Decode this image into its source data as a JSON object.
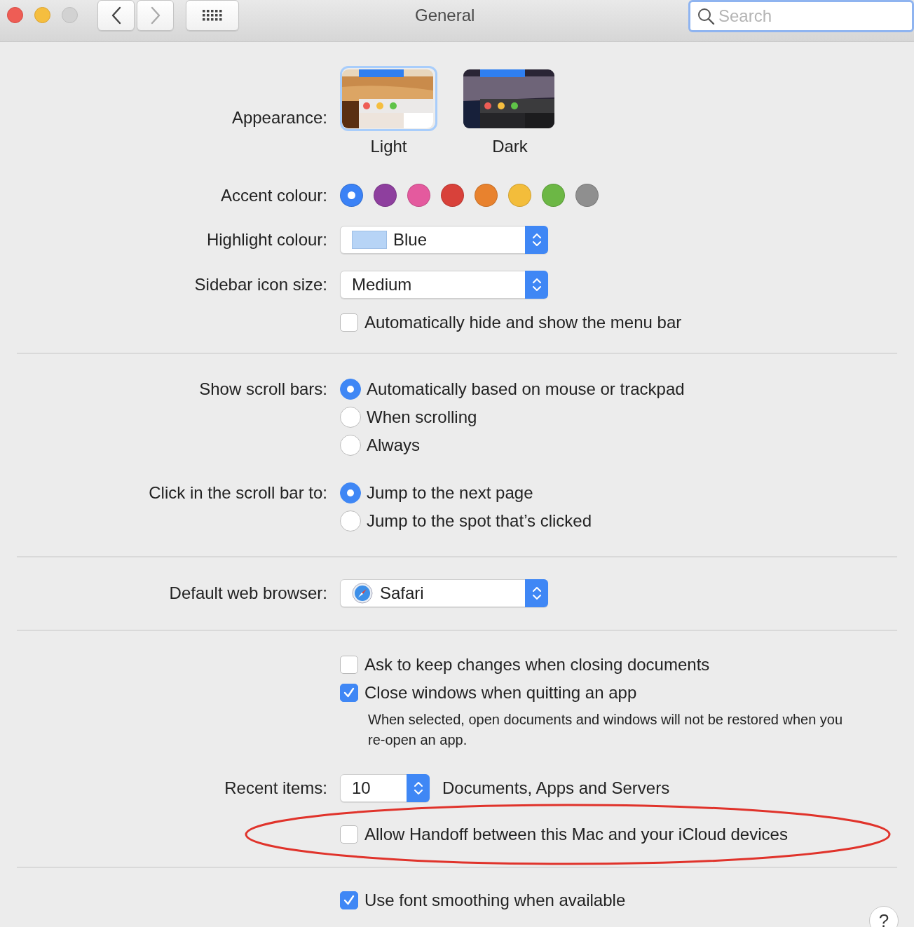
{
  "window": {
    "title": "General"
  },
  "toolbar": {
    "back_enabled": true,
    "forward_enabled": false,
    "search": {
      "placeholder": "Search"
    }
  },
  "appearance": {
    "label": "Appearance:",
    "options": [
      {
        "label": "Light",
        "kind": "light",
        "selected": true
      },
      {
        "label": "Dark",
        "kind": "dark",
        "selected": false
      }
    ]
  },
  "accent_colour": {
    "label": "Accent colour:",
    "options": [
      {
        "color": "#3b82f6",
        "selected": true
      },
      {
        "color": "#8e3f9e",
        "selected": false
      },
      {
        "color": "#e45a9e",
        "selected": false
      },
      {
        "color": "#d8413a",
        "selected": false
      },
      {
        "color": "#e8822e",
        "selected": false
      },
      {
        "color": "#f3bd3b",
        "selected": false
      },
      {
        "color": "#6cb745",
        "selected": false
      },
      {
        "color": "#8f8f8f",
        "selected": false
      }
    ]
  },
  "highlight_colour": {
    "label": "Highlight colour:",
    "value": "Blue"
  },
  "sidebar_icon_size": {
    "label": "Sidebar icon size:",
    "value": "Medium"
  },
  "menu_bar": {
    "label": "Automatically hide and show the menu bar",
    "checked": false
  },
  "show_scroll_bars": {
    "label": "Show scroll bars:",
    "options": [
      {
        "label": "Automatically based on mouse or trackpad",
        "selected": true
      },
      {
        "label": "When scrolling",
        "selected": false
      },
      {
        "label": "Always",
        "selected": false
      }
    ]
  },
  "click_scroll_bar": {
    "label": "Click in the scroll bar to:",
    "options": [
      {
        "label": "Jump to the next page",
        "selected": true
      },
      {
        "label": "Jump to the spot that’s clicked",
        "selected": false
      }
    ]
  },
  "default_browser": {
    "label": "Default web browser:",
    "value": "Safari"
  },
  "documents": [
    {
      "label": "Ask to keep changes when closing documents",
      "checked": false
    },
    {
      "label": "Close windows when quitting an app",
      "checked": true
    }
  ],
  "documents_note": "When selected, open documents and windows will not be restored when you re-open an app.",
  "recent_items": {
    "label": "Recent items:",
    "value": "10",
    "suffix": "Documents, Apps and Servers"
  },
  "handoff": {
    "label": "Allow Handoff between this Mac and your iCloud devices",
    "checked": false,
    "circled": true
  },
  "font_smoothing": {
    "label": "Use font smoothing when available",
    "checked": true
  },
  "help_button": "?"
}
